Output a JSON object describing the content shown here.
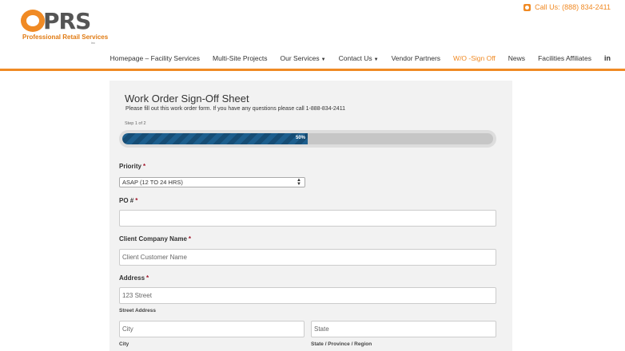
{
  "header": {
    "logo_letters": "PRS",
    "logo_name": "Professional Retail Services",
    "logo_inc": "inc",
    "call_us": "Call Us: (888) 834-2411"
  },
  "nav": {
    "items": [
      {
        "label": "Homepage – Facility Services"
      },
      {
        "label": "Multi-Site Projects"
      },
      {
        "label": "Our Services"
      },
      {
        "label": "Contact Us"
      },
      {
        "label": "Vendor Partners"
      },
      {
        "label": "W/O -Sign Off",
        "active": true
      },
      {
        "label": "News"
      },
      {
        "label": "Facilities Affiliates"
      }
    ],
    "social": "in"
  },
  "form": {
    "title": "Work Order Sign-Off Sheet",
    "subtitle": "Please fill out this work order form. If you have any questions please call 1-888-834-2411",
    "step": "Step 1 of 2",
    "progress_label": "50%",
    "progress_fraction": 0.5,
    "priority_label": "Priority",
    "priority_value": "ASAP (12 TO 24 HRS)",
    "po_label": "PO #",
    "po_value": "",
    "company_label": "Client Company Name",
    "company_placeholder": "Client Customer Name",
    "address_label": "Address",
    "street_placeholder": "123 Street",
    "street_sublabel": "Street Address",
    "city_placeholder": "City",
    "city_sublabel": "City",
    "state_placeholder": "State",
    "state_sublabel": "State / Province / Region",
    "required_mark": "*"
  },
  "colors": {
    "accent": "#f08a24",
    "progress": "#1d5f8e",
    "required": "#a2152a"
  }
}
